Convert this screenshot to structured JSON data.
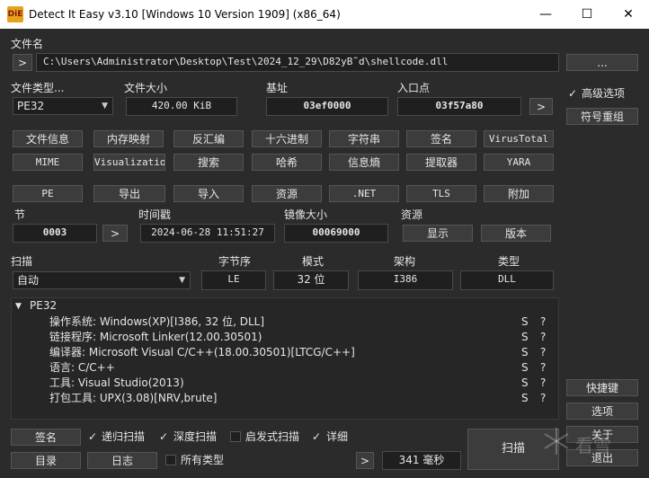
{
  "window": {
    "title": "Detect It Easy v3.10 [Windows 10 Version 1909] (x86_64)",
    "icon_text": "DiE",
    "minimize": "—",
    "maximize": "☐",
    "close": "✕"
  },
  "file": {
    "label": "文件名",
    "path": "C:\\Users\\Administrator\\Desktop\\Test\\2024_12_29\\D82yB˜d\\shellcode.dll",
    "expand_btn": ">",
    "browse_btn": "..."
  },
  "info": {
    "type_label": "文件类型...",
    "type_value": "PE32",
    "size_label": "文件大小",
    "size_value": "420.00 KiB",
    "base_label": "基址",
    "base_value": "03ef0000",
    "entry_label": "入口点",
    "entry_value": "03f57a80",
    "entry_btn": ">"
  },
  "right": {
    "advanced_label": "高级选项",
    "advanced_checked": "✓",
    "reorg_btn": "符号重组",
    "shortcuts_btn": "快捷键",
    "options_btn": "选项",
    "about_btn": "关于",
    "exit_btn": "退出"
  },
  "tools_row1": [
    "文件信息",
    "内存映射",
    "反汇编",
    "十六进制",
    "字符串",
    "签名",
    "VirusTotal"
  ],
  "tools_row2": [
    "MIME",
    "Visualization",
    "搜索",
    "哈希",
    "信息熵",
    "提取器",
    "YARA"
  ],
  "pe_row": [
    "PE",
    "导出",
    "导入",
    "资源",
    ".NET",
    "TLS",
    "附加"
  ],
  "sections": {
    "section_label": "节",
    "section_value": "0003",
    "section_btn": ">",
    "time_label": "时间戳",
    "time_value": "2024-06-28 11:51:27",
    "image_label": "镜像大小",
    "image_value": "00069000",
    "res_label": "资源",
    "show_btn": "显示",
    "version_btn": "版本"
  },
  "scan": {
    "scan_label": "扫描",
    "scan_value": "自动",
    "endian_label": "字节序",
    "endian_value": "LE",
    "mode_label": "模式",
    "mode_value": "32 位",
    "arch_label": "架构",
    "arch_value": "I386",
    "type_label": "类型",
    "type_value": "DLL"
  },
  "results": {
    "root": "PE32",
    "root_arrow": "▼",
    "items": [
      {
        "text": "操作系统: Windows(XP)[I386, 32 位, DLL]",
        "s": "S",
        "q": "?"
      },
      {
        "text": "链接程序: Microsoft Linker(12.00.30501)",
        "s": "S",
        "q": "?"
      },
      {
        "text": "编译器: Microsoft Visual C/C++(18.00.30501)[LTCG/C++]",
        "s": "S",
        "q": "?"
      },
      {
        "text": "语言: C/C++",
        "s": "S",
        "q": "?"
      },
      {
        "text": "工具: Visual Studio(2013)",
        "s": "S",
        "q": "?"
      },
      {
        "text": "打包工具: UPX(3.08)[NRV,brute]",
        "s": "S",
        "q": "?"
      }
    ]
  },
  "bottom": {
    "sign_btn": "签名",
    "recursive_label": "递归扫描",
    "deep_label": "深度扫描",
    "heuristic_label": "启发式扫描",
    "verbose_label": "详细",
    "dir_btn": "目录",
    "log_btn": "日志",
    "alltypes_label": "所有类型",
    "time_btn": ">",
    "time_value": "341 毫秒",
    "scan_btn": "扫描",
    "check": "✓"
  },
  "watermark": "看雪"
}
